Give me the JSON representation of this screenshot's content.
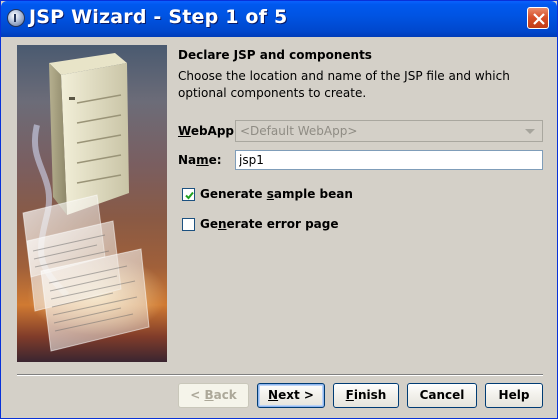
{
  "window": {
    "title": "JSP Wizard - Step 1 of 5"
  },
  "content": {
    "heading": "Declare JSP and components",
    "description": "Choose the location and name of the JSP file and which optional components to create."
  },
  "form": {
    "webapp": {
      "label_prefix": "W",
      "label_rest": "ebApp:",
      "value": "<Default WebApp>",
      "enabled": false
    },
    "name": {
      "label_prefix": "Na",
      "label_mnemonic": "m",
      "label_rest": "e:",
      "value": "jsp1"
    },
    "generate_sample_bean": {
      "label_prefix": "Generate ",
      "label_mnemonic": "s",
      "label_rest": "ample bean",
      "checked": true
    },
    "generate_error_page": {
      "label_prefix": "Ge",
      "label_mnemonic": "n",
      "label_rest": "erate error page",
      "checked": false
    }
  },
  "buttons": {
    "back": {
      "prefix": "< ",
      "mnemonic": "B",
      "rest": "ack",
      "enabled": false
    },
    "next": {
      "mnemonic": "N",
      "rest": "ext >",
      "enabled": true
    },
    "finish": {
      "mnemonic": "F",
      "rest": "inish",
      "enabled": true
    },
    "cancel": {
      "label": "Cancel",
      "enabled": true
    },
    "help": {
      "label": "Help",
      "enabled": true
    }
  },
  "colors": {
    "titlebar": "#0054e3",
    "dialog_bg": "#d4d0c8",
    "close_button": "#d8502b"
  },
  "icons": {
    "app": "java-cup-icon",
    "close": "close-x-icon",
    "combo_arrow": "chevron-down-icon",
    "check": "checkmark-icon"
  }
}
